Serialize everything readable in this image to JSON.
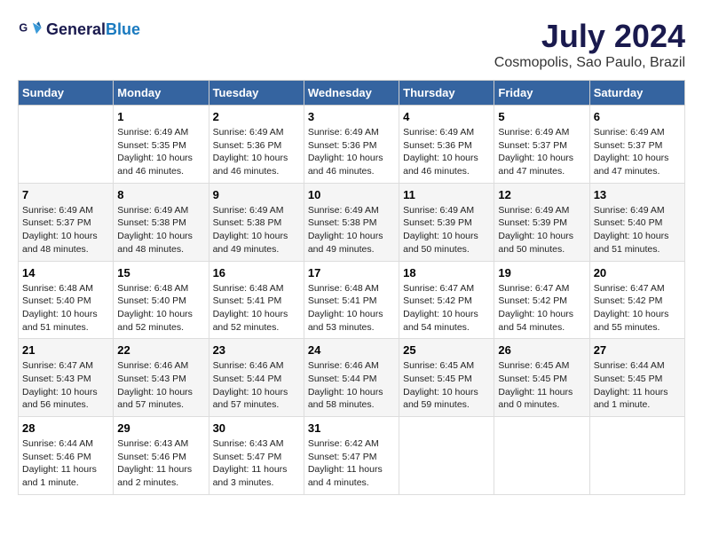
{
  "logo": {
    "line1": "General",
    "line2": "Blue"
  },
  "title": "July 2024",
  "subtitle": "Cosmopolis, Sao Paulo, Brazil",
  "days": [
    "Sunday",
    "Monday",
    "Tuesday",
    "Wednesday",
    "Thursday",
    "Friday",
    "Saturday"
  ],
  "weeks": [
    [
      {
        "date": "",
        "text": ""
      },
      {
        "date": "1",
        "text": "Sunrise: 6:49 AM\nSunset: 5:35 PM\nDaylight: 10 hours and 46 minutes."
      },
      {
        "date": "2",
        "text": "Sunrise: 6:49 AM\nSunset: 5:36 PM\nDaylight: 10 hours and 46 minutes."
      },
      {
        "date": "3",
        "text": "Sunrise: 6:49 AM\nSunset: 5:36 PM\nDaylight: 10 hours and 46 minutes."
      },
      {
        "date": "4",
        "text": "Sunrise: 6:49 AM\nSunset: 5:36 PM\nDaylight: 10 hours and 46 minutes."
      },
      {
        "date": "5",
        "text": "Sunrise: 6:49 AM\nSunset: 5:37 PM\nDaylight: 10 hours and 47 minutes."
      },
      {
        "date": "6",
        "text": "Sunrise: 6:49 AM\nSunset: 5:37 PM\nDaylight: 10 hours and 47 minutes."
      }
    ],
    [
      {
        "date": "7",
        "text": "Sunrise: 6:49 AM\nSunset: 5:37 PM\nDaylight: 10 hours and 48 minutes."
      },
      {
        "date": "8",
        "text": "Sunrise: 6:49 AM\nSunset: 5:38 PM\nDaylight: 10 hours and 48 minutes."
      },
      {
        "date": "9",
        "text": "Sunrise: 6:49 AM\nSunset: 5:38 PM\nDaylight: 10 hours and 49 minutes."
      },
      {
        "date": "10",
        "text": "Sunrise: 6:49 AM\nSunset: 5:38 PM\nDaylight: 10 hours and 49 minutes."
      },
      {
        "date": "11",
        "text": "Sunrise: 6:49 AM\nSunset: 5:39 PM\nDaylight: 10 hours and 50 minutes."
      },
      {
        "date": "12",
        "text": "Sunrise: 6:49 AM\nSunset: 5:39 PM\nDaylight: 10 hours and 50 minutes."
      },
      {
        "date": "13",
        "text": "Sunrise: 6:49 AM\nSunset: 5:40 PM\nDaylight: 10 hours and 51 minutes."
      }
    ],
    [
      {
        "date": "14",
        "text": "Sunrise: 6:48 AM\nSunset: 5:40 PM\nDaylight: 10 hours and 51 minutes."
      },
      {
        "date": "15",
        "text": "Sunrise: 6:48 AM\nSunset: 5:40 PM\nDaylight: 10 hours and 52 minutes."
      },
      {
        "date": "16",
        "text": "Sunrise: 6:48 AM\nSunset: 5:41 PM\nDaylight: 10 hours and 52 minutes."
      },
      {
        "date": "17",
        "text": "Sunrise: 6:48 AM\nSunset: 5:41 PM\nDaylight: 10 hours and 53 minutes."
      },
      {
        "date": "18",
        "text": "Sunrise: 6:47 AM\nSunset: 5:42 PM\nDaylight: 10 hours and 54 minutes."
      },
      {
        "date": "19",
        "text": "Sunrise: 6:47 AM\nSunset: 5:42 PM\nDaylight: 10 hours and 54 minutes."
      },
      {
        "date": "20",
        "text": "Sunrise: 6:47 AM\nSunset: 5:42 PM\nDaylight: 10 hours and 55 minutes."
      }
    ],
    [
      {
        "date": "21",
        "text": "Sunrise: 6:47 AM\nSunset: 5:43 PM\nDaylight: 10 hours and 56 minutes."
      },
      {
        "date": "22",
        "text": "Sunrise: 6:46 AM\nSunset: 5:43 PM\nDaylight: 10 hours and 57 minutes."
      },
      {
        "date": "23",
        "text": "Sunrise: 6:46 AM\nSunset: 5:44 PM\nDaylight: 10 hours and 57 minutes."
      },
      {
        "date": "24",
        "text": "Sunrise: 6:46 AM\nSunset: 5:44 PM\nDaylight: 10 hours and 58 minutes."
      },
      {
        "date": "25",
        "text": "Sunrise: 6:45 AM\nSunset: 5:45 PM\nDaylight: 10 hours and 59 minutes."
      },
      {
        "date": "26",
        "text": "Sunrise: 6:45 AM\nSunset: 5:45 PM\nDaylight: 11 hours and 0 minutes."
      },
      {
        "date": "27",
        "text": "Sunrise: 6:44 AM\nSunset: 5:45 PM\nDaylight: 11 hours and 1 minute."
      }
    ],
    [
      {
        "date": "28",
        "text": "Sunrise: 6:44 AM\nSunset: 5:46 PM\nDaylight: 11 hours and 1 minute."
      },
      {
        "date": "29",
        "text": "Sunrise: 6:43 AM\nSunset: 5:46 PM\nDaylight: 11 hours and 2 minutes."
      },
      {
        "date": "30",
        "text": "Sunrise: 6:43 AM\nSunset: 5:47 PM\nDaylight: 11 hours and 3 minutes."
      },
      {
        "date": "31",
        "text": "Sunrise: 6:42 AM\nSunset: 5:47 PM\nDaylight: 11 hours and 4 minutes."
      },
      {
        "date": "",
        "text": ""
      },
      {
        "date": "",
        "text": ""
      },
      {
        "date": "",
        "text": ""
      }
    ]
  ]
}
